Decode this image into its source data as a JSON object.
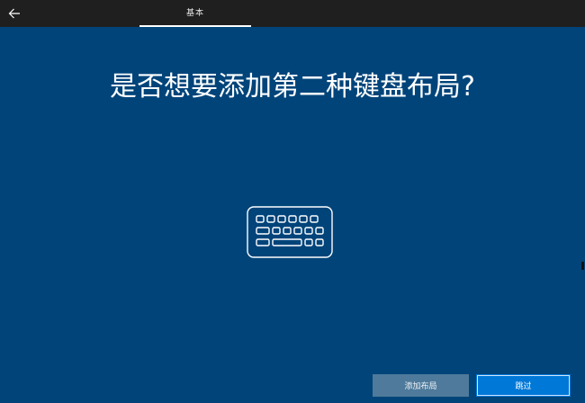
{
  "topbar": {
    "back_icon": "arrow-left-icon",
    "tab_label": "基本"
  },
  "main": {
    "heading": "是否想要添加第二种键盘布局?",
    "illustration_icon": "keyboard-icon"
  },
  "buttons": {
    "add_label": "添加布局",
    "skip_label": "跳过"
  },
  "colors": {
    "background": "#00447a",
    "topbar": "#1f1f1f",
    "primary_button": "#0078d7",
    "secondary_button": "#4f7a9b"
  }
}
